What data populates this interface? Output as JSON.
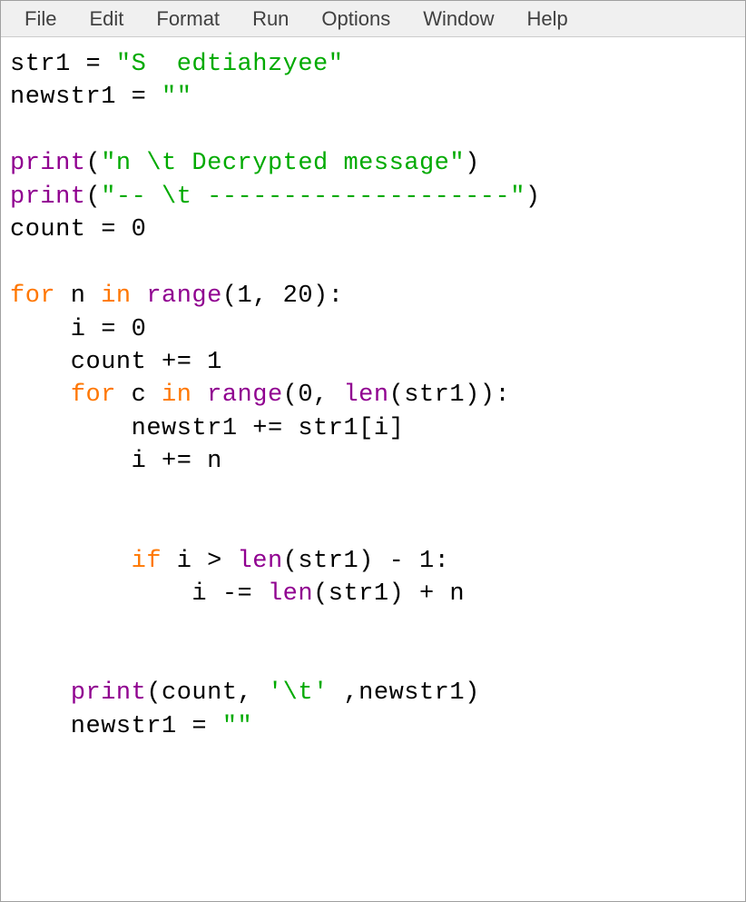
{
  "menu": {
    "file": "File",
    "edit": "Edit",
    "format": "Format",
    "run": "Run",
    "options": "Options",
    "window": "Window",
    "help": "Help"
  },
  "code": {
    "t01": "str1 = ",
    "t02": "\"S  edtiahzyee\"",
    "t03": "newstr1 = ",
    "t04": "\"\"",
    "t05": "print",
    "t06": "(",
    "t07": "\"n \\t Decrypted message\"",
    "t08": ")",
    "t09": "print",
    "t10": "(",
    "t11": "\"-- \\t --------------------\"",
    "t12": ")",
    "t13": "count = 0",
    "t14": "for",
    "t15": " n ",
    "t16": "in",
    "t17": " ",
    "t18": "range",
    "t19": "(1, 20):",
    "t20": "    i = 0",
    "t21": "    count += 1",
    "t22": "    ",
    "t23": "for",
    "t24": " c ",
    "t25": "in",
    "t26": " ",
    "t27": "range",
    "t28": "(0, ",
    "t29": "len",
    "t30": "(str1)):",
    "t31": "        newstr1 += str1[i]",
    "t32": "        i += n",
    "t33": "        ",
    "t34": "if",
    "t35": " i > ",
    "t36": "len",
    "t37": "(str1) - 1:",
    "t38": "            i -= ",
    "t39": "len",
    "t40": "(str1) + n",
    "t41": "    ",
    "t42": "print",
    "t43": "(count, ",
    "t44": "'\\t'",
    "t45": " ,newstr1)",
    "t46": "    newstr1 = ",
    "t47": "\"\""
  }
}
